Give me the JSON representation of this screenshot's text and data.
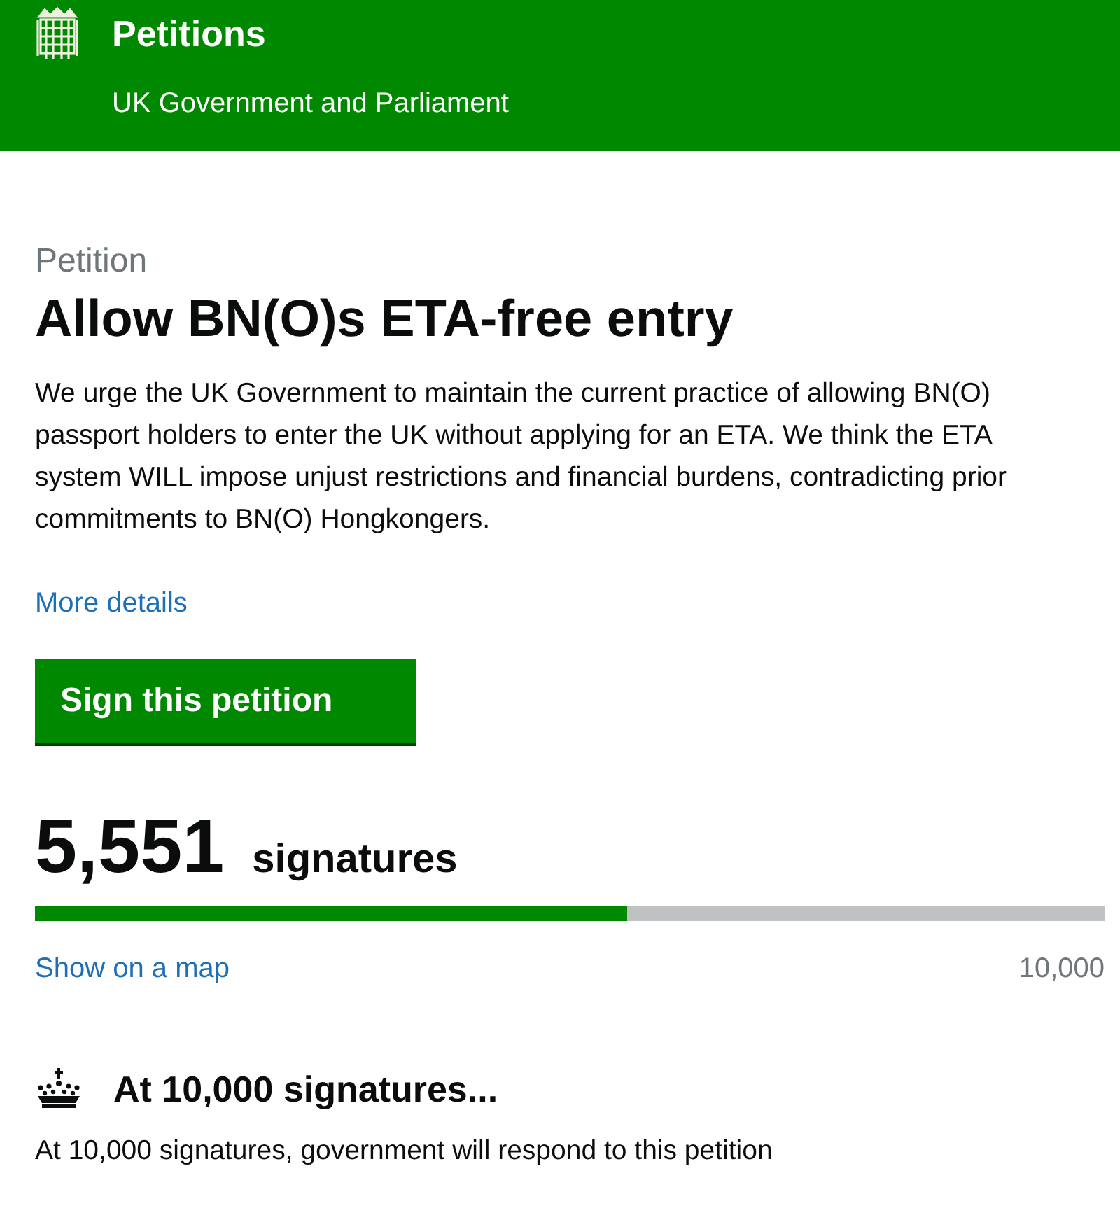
{
  "header": {
    "title": "Petitions",
    "subtitle": "UK Government and Parliament"
  },
  "petition": {
    "caption": "Petition",
    "title": "Allow BN(O)s ETA-free entry",
    "description": "We urge the UK Government to maintain the current practice of allowing BN(O) passport holders to enter the UK without applying for an ETA. We think the ETA system WILL impose unjust restrictions and financial burdens, contradicting prior commitments to BN(O) Hongkongers.",
    "more_link": "More details",
    "sign_button": "Sign this petition"
  },
  "signatures": {
    "count": "5,551",
    "label": "signatures",
    "level": 0.554,
    "map_link": "Show on a map",
    "target": "10,000"
  },
  "threshold": {
    "heading": "At 10,000 signatures...",
    "text": "At 10,000 signatures, government will respond to this petition"
  }
}
